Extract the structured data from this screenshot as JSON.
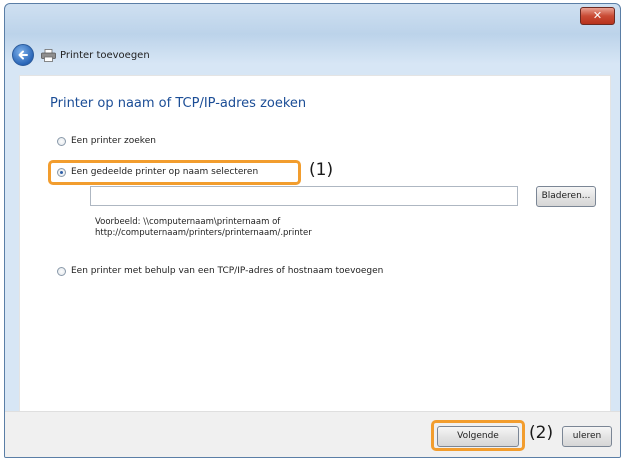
{
  "window": {
    "close_glyph": "✕",
    "title": "Printer toevoegen",
    "icons": [
      "back-arrow-icon",
      "printer-icon",
      "close-icon"
    ]
  },
  "main": {
    "heading": "Printer op naam of TCP/IP-adres zoeken",
    "options": [
      {
        "label": "Een printer zoeken",
        "selected": false
      },
      {
        "label": "Een gedeelde printer op naam selecteren",
        "selected": true
      },
      {
        "label": "Een printer met behulp van een TCP/IP-adres of hostnaam toevoegen",
        "selected": false
      }
    ],
    "printer_name_value": "",
    "browse_label": "Bladeren...",
    "example_line1": "Voorbeeld: \\\\computernaam\\printernaam of",
    "example_line2": "http://computernaam/printers/printernaam/.printer"
  },
  "annotations": {
    "callout1": "(1)",
    "callout2": "(2)",
    "highlight_color": "#f29d2e"
  },
  "footer": {
    "next_label": "Volgende",
    "cancel_label": "uleren"
  }
}
